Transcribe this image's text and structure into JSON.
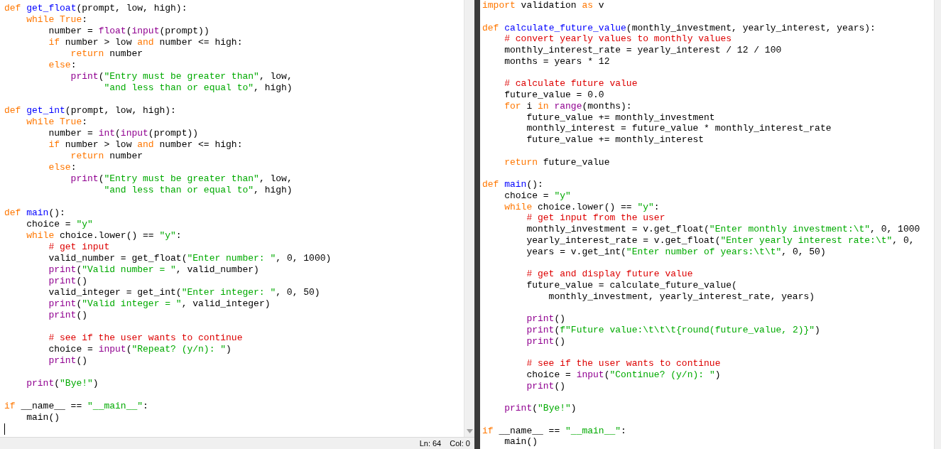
{
  "editors": [
    {
      "lines": [
        {
          "kind": "code",
          "tokens": [
            {
              "kind": "keyword",
              "text": "def "
            },
            {
              "kind": "definition",
              "text": "get_float"
            },
            {
              "kind": "plain",
              "text": "(prompt, low, high):"
            }
          ]
        },
        {
          "kind": "code",
          "tokens": [
            {
              "kind": "keyword",
              "text": "    while True"
            },
            {
              "kind": "plain",
              "text": ":"
            }
          ]
        },
        {
          "kind": "code",
          "tokens": [
            {
              "kind": "plain",
              "text": "        number = "
            },
            {
              "kind": "builtin",
              "text": "float"
            },
            {
              "kind": "plain",
              "text": "("
            },
            {
              "kind": "builtin",
              "text": "input"
            },
            {
              "kind": "plain",
              "text": "(prompt))"
            }
          ]
        },
        {
          "kind": "code",
          "tokens": [
            {
              "kind": "keyword",
              "text": "        if"
            },
            {
              "kind": "plain",
              "text": " number > low "
            },
            {
              "kind": "keyword",
              "text": "and"
            },
            {
              "kind": "plain",
              "text": " number <= high:"
            }
          ]
        },
        {
          "kind": "code",
          "tokens": [
            {
              "kind": "keyword",
              "text": "            return"
            },
            {
              "kind": "plain",
              "text": " number"
            }
          ]
        },
        {
          "kind": "code",
          "tokens": [
            {
              "kind": "keyword",
              "text": "        else"
            },
            {
              "kind": "plain",
              "text": ":"
            }
          ]
        },
        {
          "kind": "code",
          "tokens": [
            {
              "kind": "builtin",
              "text": "            print"
            },
            {
              "kind": "plain",
              "text": "("
            },
            {
              "kind": "string",
              "text": "\"Entry must be greater than\""
            },
            {
              "kind": "plain",
              "text": ", low,"
            }
          ]
        },
        {
          "kind": "code",
          "tokens": [
            {
              "kind": "string",
              "text": "                  \"and less than or equal to\""
            },
            {
              "kind": "plain",
              "text": ", high)"
            }
          ]
        },
        {
          "kind": "blank"
        },
        {
          "kind": "code",
          "tokens": [
            {
              "kind": "keyword",
              "text": "def "
            },
            {
              "kind": "definition",
              "text": "get_int"
            },
            {
              "kind": "plain",
              "text": "(prompt, low, high):"
            }
          ]
        },
        {
          "kind": "code",
          "tokens": [
            {
              "kind": "keyword",
              "text": "    while True"
            },
            {
              "kind": "plain",
              "text": ":"
            }
          ]
        },
        {
          "kind": "code",
          "tokens": [
            {
              "kind": "plain",
              "text": "        number = "
            },
            {
              "kind": "builtin",
              "text": "int"
            },
            {
              "kind": "plain",
              "text": "("
            },
            {
              "kind": "builtin",
              "text": "input"
            },
            {
              "kind": "plain",
              "text": "(prompt))"
            }
          ]
        },
        {
          "kind": "code",
          "tokens": [
            {
              "kind": "keyword",
              "text": "        if"
            },
            {
              "kind": "plain",
              "text": " number > low "
            },
            {
              "kind": "keyword",
              "text": "and"
            },
            {
              "kind": "plain",
              "text": " number <= high:"
            }
          ]
        },
        {
          "kind": "code",
          "tokens": [
            {
              "kind": "keyword",
              "text": "            return"
            },
            {
              "kind": "plain",
              "text": " number"
            }
          ]
        },
        {
          "kind": "code",
          "tokens": [
            {
              "kind": "keyword",
              "text": "        else"
            },
            {
              "kind": "plain",
              "text": ":"
            }
          ]
        },
        {
          "kind": "code",
          "tokens": [
            {
              "kind": "builtin",
              "text": "            print"
            },
            {
              "kind": "plain",
              "text": "("
            },
            {
              "kind": "string",
              "text": "\"Entry must be greater than\""
            },
            {
              "kind": "plain",
              "text": ", low,"
            }
          ]
        },
        {
          "kind": "code",
          "tokens": [
            {
              "kind": "string",
              "text": "                  \"and less than or equal to\""
            },
            {
              "kind": "plain",
              "text": ", high)"
            }
          ]
        },
        {
          "kind": "blank"
        },
        {
          "kind": "code",
          "tokens": [
            {
              "kind": "keyword",
              "text": "def "
            },
            {
              "kind": "definition",
              "text": "main"
            },
            {
              "kind": "plain",
              "text": "():"
            }
          ]
        },
        {
          "kind": "code",
          "tokens": [
            {
              "kind": "plain",
              "text": "    choice = "
            },
            {
              "kind": "string",
              "text": "\"y\""
            }
          ]
        },
        {
          "kind": "code",
          "tokens": [
            {
              "kind": "keyword",
              "text": "    while"
            },
            {
              "kind": "plain",
              "text": " choice.lower() == "
            },
            {
              "kind": "string",
              "text": "\"y\""
            },
            {
              "kind": "plain",
              "text": ":"
            }
          ]
        },
        {
          "kind": "code",
          "tokens": [
            {
              "kind": "comment",
              "text": "        # get input"
            }
          ]
        },
        {
          "kind": "code",
          "tokens": [
            {
              "kind": "plain",
              "text": "        valid_number = get_float("
            },
            {
              "kind": "string",
              "text": "\"Enter number: \""
            },
            {
              "kind": "plain",
              "text": ", 0, 1000)"
            }
          ]
        },
        {
          "kind": "code",
          "tokens": [
            {
              "kind": "builtin",
              "text": "        print"
            },
            {
              "kind": "plain",
              "text": "("
            },
            {
              "kind": "string",
              "text": "\"Valid number = \""
            },
            {
              "kind": "plain",
              "text": ", valid_number)"
            }
          ]
        },
        {
          "kind": "code",
          "tokens": [
            {
              "kind": "builtin",
              "text": "        print"
            },
            {
              "kind": "plain",
              "text": "()"
            }
          ]
        },
        {
          "kind": "code",
          "tokens": [
            {
              "kind": "plain",
              "text": "        valid_integer = get_int("
            },
            {
              "kind": "string",
              "text": "\"Enter integer: \""
            },
            {
              "kind": "plain",
              "text": ", 0, 50)"
            }
          ]
        },
        {
          "kind": "code",
          "tokens": [
            {
              "kind": "builtin",
              "text": "        print"
            },
            {
              "kind": "plain",
              "text": "("
            },
            {
              "kind": "string",
              "text": "\"Valid integer = \""
            },
            {
              "kind": "plain",
              "text": ", valid_integer)"
            }
          ]
        },
        {
          "kind": "code",
          "tokens": [
            {
              "kind": "builtin",
              "text": "        print"
            },
            {
              "kind": "plain",
              "text": "()"
            }
          ]
        },
        {
          "kind": "blank"
        },
        {
          "kind": "code",
          "tokens": [
            {
              "kind": "comment",
              "text": "        # see if the user wants to continue"
            }
          ]
        },
        {
          "kind": "code",
          "tokens": [
            {
              "kind": "plain",
              "text": "        choice = "
            },
            {
              "kind": "builtin",
              "text": "input"
            },
            {
              "kind": "plain",
              "text": "("
            },
            {
              "kind": "string",
              "text": "\"Repeat? (y/n): \""
            },
            {
              "kind": "plain",
              "text": ")"
            }
          ]
        },
        {
          "kind": "code",
          "tokens": [
            {
              "kind": "builtin",
              "text": "        print"
            },
            {
              "kind": "plain",
              "text": "()"
            }
          ]
        },
        {
          "kind": "blank"
        },
        {
          "kind": "code",
          "tokens": [
            {
              "kind": "builtin",
              "text": "    print"
            },
            {
              "kind": "plain",
              "text": "("
            },
            {
              "kind": "string",
              "text": "\"Bye!\""
            },
            {
              "kind": "plain",
              "text": ")"
            }
          ]
        },
        {
          "kind": "blank"
        },
        {
          "kind": "code",
          "tokens": [
            {
              "kind": "keyword",
              "text": "if"
            },
            {
              "kind": "plain",
              "text": " __name__ == "
            },
            {
              "kind": "string",
              "text": "\"__main__\""
            },
            {
              "kind": "plain",
              "text": ":"
            }
          ]
        },
        {
          "kind": "code",
          "tokens": [
            {
              "kind": "plain",
              "text": "    main()"
            }
          ]
        },
        {
          "kind": "cursor"
        }
      ],
      "status_bar": {
        "line": "Ln: 64",
        "column": "Col: 0"
      }
    },
    {
      "lines": [
        {
          "kind": "code",
          "tokens": [
            {
              "kind": "keyword",
              "text": "import"
            },
            {
              "kind": "plain",
              "text": " validation "
            },
            {
              "kind": "keyword",
              "text": "as"
            },
            {
              "kind": "plain",
              "text": " v"
            }
          ]
        },
        {
          "kind": "blank"
        },
        {
          "kind": "code",
          "tokens": [
            {
              "kind": "keyword",
              "text": "def "
            },
            {
              "kind": "definition",
              "text": "calculate_future_value"
            },
            {
              "kind": "plain",
              "text": "(monthly_investment, yearly_interest, years):"
            }
          ]
        },
        {
          "kind": "code",
          "tokens": [
            {
              "kind": "comment",
              "text": "    # convert yearly values to monthly values"
            }
          ]
        },
        {
          "kind": "code",
          "tokens": [
            {
              "kind": "plain",
              "text": "    monthly_interest_rate = yearly_interest / 12 / 100"
            }
          ]
        },
        {
          "kind": "code",
          "tokens": [
            {
              "kind": "plain",
              "text": "    months = years * 12"
            }
          ]
        },
        {
          "kind": "blank"
        },
        {
          "kind": "code",
          "tokens": [
            {
              "kind": "comment",
              "text": "    # calculate future value"
            }
          ]
        },
        {
          "kind": "code",
          "tokens": [
            {
              "kind": "plain",
              "text": "    future_value = 0.0"
            }
          ]
        },
        {
          "kind": "code",
          "tokens": [
            {
              "kind": "keyword",
              "text": "    for"
            },
            {
              "kind": "plain",
              "text": " i "
            },
            {
              "kind": "keyword",
              "text": "in "
            },
            {
              "kind": "builtin",
              "text": "range"
            },
            {
              "kind": "plain",
              "text": "(months):"
            }
          ]
        },
        {
          "kind": "code",
          "tokens": [
            {
              "kind": "plain",
              "text": "        future_value += monthly_investment"
            }
          ]
        },
        {
          "kind": "code",
          "tokens": [
            {
              "kind": "plain",
              "text": "        monthly_interest = future_value * monthly_interest_rate"
            }
          ]
        },
        {
          "kind": "code",
          "tokens": [
            {
              "kind": "plain",
              "text": "        future_value += monthly_interest"
            }
          ]
        },
        {
          "kind": "blank"
        },
        {
          "kind": "code",
          "tokens": [
            {
              "kind": "keyword",
              "text": "    return"
            },
            {
              "kind": "plain",
              "text": " future_value"
            }
          ]
        },
        {
          "kind": "blank"
        },
        {
          "kind": "code",
          "tokens": [
            {
              "kind": "keyword",
              "text": "def "
            },
            {
              "kind": "definition",
              "text": "main"
            },
            {
              "kind": "plain",
              "text": "():"
            }
          ]
        },
        {
          "kind": "code",
          "tokens": [
            {
              "kind": "plain",
              "text": "    choice = "
            },
            {
              "kind": "string",
              "text": "\"y\""
            }
          ]
        },
        {
          "kind": "code",
          "tokens": [
            {
              "kind": "keyword",
              "text": "    while"
            },
            {
              "kind": "plain",
              "text": " choice.lower() == "
            },
            {
              "kind": "string",
              "text": "\"y\""
            },
            {
              "kind": "plain",
              "text": ":"
            }
          ]
        },
        {
          "kind": "code",
          "tokens": [
            {
              "kind": "comment",
              "text": "        # get input from the user"
            }
          ]
        },
        {
          "kind": "code",
          "tokens": [
            {
              "kind": "plain",
              "text": "        monthly_investment = v.get_float("
            },
            {
              "kind": "string",
              "text": "\"Enter monthly investment:\\t\""
            },
            {
              "kind": "plain",
              "text": ", 0, 1000"
            }
          ]
        },
        {
          "kind": "code",
          "tokens": [
            {
              "kind": "plain",
              "text": "        yearly_interest_rate = v.get_float("
            },
            {
              "kind": "string",
              "text": "\"Enter yearly interest rate:\\t\""
            },
            {
              "kind": "plain",
              "text": ", 0,"
            }
          ]
        },
        {
          "kind": "code",
          "tokens": [
            {
              "kind": "plain",
              "text": "        years = v.get_int("
            },
            {
              "kind": "string",
              "text": "\"Enter number of years:\\t\\t\""
            },
            {
              "kind": "plain",
              "text": ", 0, 50)"
            }
          ]
        },
        {
          "kind": "blank"
        },
        {
          "kind": "code",
          "tokens": [
            {
              "kind": "comment",
              "text": "        # get and display future value"
            }
          ]
        },
        {
          "kind": "code",
          "tokens": [
            {
              "kind": "plain",
              "text": "        future_value = calculate_future_value("
            }
          ]
        },
        {
          "kind": "code",
          "tokens": [
            {
              "kind": "plain",
              "text": "            monthly_investment, yearly_interest_rate, years)"
            }
          ]
        },
        {
          "kind": "blank"
        },
        {
          "kind": "code",
          "tokens": [
            {
              "kind": "builtin",
              "text": "        print"
            },
            {
              "kind": "plain",
              "text": "()"
            }
          ]
        },
        {
          "kind": "code",
          "tokens": [
            {
              "kind": "builtin",
              "text": "        print"
            },
            {
              "kind": "plain",
              "text": "("
            },
            {
              "kind": "string",
              "text": "f\"Future value:\\t\\t\\t{round(future_value, 2)}\""
            },
            {
              "kind": "plain",
              "text": ")"
            }
          ]
        },
        {
          "kind": "code",
          "tokens": [
            {
              "kind": "builtin",
              "text": "        print"
            },
            {
              "kind": "plain",
              "text": "()"
            }
          ]
        },
        {
          "kind": "blank"
        },
        {
          "kind": "code",
          "tokens": [
            {
              "kind": "comment",
              "text": "        # see if the user wants to continue"
            }
          ]
        },
        {
          "kind": "code",
          "tokens": [
            {
              "kind": "plain",
              "text": "        choice = "
            },
            {
              "kind": "builtin",
              "text": "input"
            },
            {
              "kind": "plain",
              "text": "("
            },
            {
              "kind": "string",
              "text": "\"Continue? (y/n): \""
            },
            {
              "kind": "plain",
              "text": ")"
            }
          ]
        },
        {
          "kind": "code",
          "tokens": [
            {
              "kind": "builtin",
              "text": "        print"
            },
            {
              "kind": "plain",
              "text": "()"
            }
          ]
        },
        {
          "kind": "blank"
        },
        {
          "kind": "code",
          "tokens": [
            {
              "kind": "builtin",
              "text": "    print"
            },
            {
              "kind": "plain",
              "text": "("
            },
            {
              "kind": "string",
              "text": "\"Bye!\""
            },
            {
              "kind": "plain",
              "text": ")"
            }
          ]
        },
        {
          "kind": "blank"
        },
        {
          "kind": "code",
          "tokens": [
            {
              "kind": "keyword",
              "text": "if"
            },
            {
              "kind": "plain",
              "text": " __name__ == "
            },
            {
              "kind": "string",
              "text": "\"__main__\""
            },
            {
              "kind": "plain",
              "text": ":"
            }
          ]
        },
        {
          "kind": "code",
          "tokens": [
            {
              "kind": "plain",
              "text": "    main()"
            }
          ]
        }
      ]
    }
  ]
}
